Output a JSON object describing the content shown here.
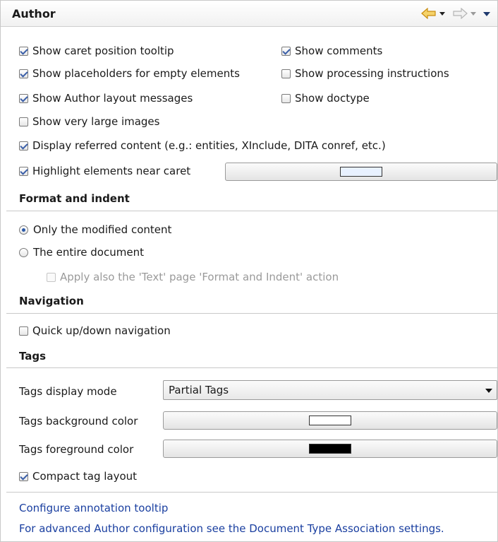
{
  "header": {
    "title": "Author",
    "icons": [
      "back-arrow-icon",
      "dropdown-icon",
      "forward-arrow-icon",
      "dropdown-icon",
      "view-menu-icon"
    ]
  },
  "options": {
    "show_caret_tooltip": {
      "label": "Show caret position tooltip",
      "checked": true
    },
    "show_comments": {
      "label": "Show comments",
      "checked": true
    },
    "show_placeholders": {
      "label": "Show placeholders for empty elements",
      "checked": true
    },
    "show_processing": {
      "label": "Show processing instructions",
      "checked": false
    },
    "show_layout_messages": {
      "label": "Show Author layout messages",
      "checked": true
    },
    "show_doctype": {
      "label": "Show doctype",
      "checked": false
    },
    "show_large_images": {
      "label": "Show very large images",
      "checked": false
    },
    "display_referred": {
      "label": "Display referred content (e.g.: entities, XInclude, DITA conref, etc.)",
      "checked": true
    },
    "highlight_near_caret": {
      "label": "Highlight elements near caret",
      "checked": true,
      "color": "#e8f1ff"
    }
  },
  "format_indent": {
    "heading": "Format and indent",
    "only_modified": {
      "label": "Only the modified content",
      "selected": true
    },
    "entire_document": {
      "label": "The entire document",
      "selected": false
    },
    "apply_text_page": {
      "label": "Apply also the 'Text' page 'Format and Indent' action",
      "checked": false,
      "enabled": false
    }
  },
  "navigation": {
    "heading": "Navigation",
    "quick_updown": {
      "label": "Quick up/down navigation",
      "checked": false
    }
  },
  "tags": {
    "heading": "Tags",
    "display_mode_label": "Tags display mode",
    "display_mode_value": "Partial Tags",
    "bg_label": "Tags background color",
    "bg_color": "#ffffff",
    "fg_label": "Tags foreground color",
    "fg_color": "#000000",
    "compact": {
      "label": "Compact tag layout",
      "checked": true
    }
  },
  "links": {
    "annotation_tooltip": "Configure annotation tooltip",
    "advanced_config": "For advanced Author configuration see the Document Type Association settings."
  },
  "colors": {
    "accent": "#3b5fa8",
    "link": "#1a3fa0",
    "back_arrow": "#e8b23a"
  }
}
